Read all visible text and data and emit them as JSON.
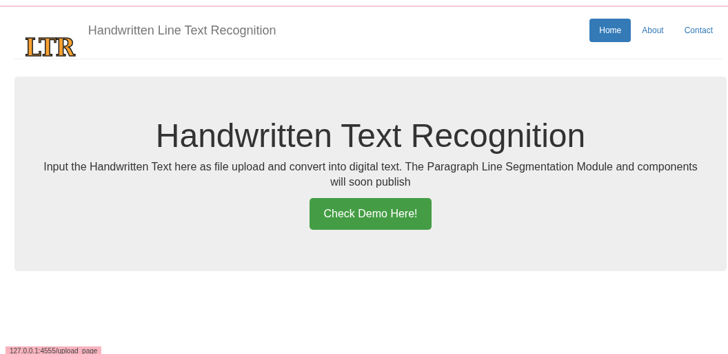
{
  "navbar": {
    "logo": "LTR",
    "title": "Handwritten Line Text Recognition",
    "links": [
      {
        "label": "Home",
        "selected": true
      },
      {
        "label": "About",
        "selected": false
      },
      {
        "label": "Contact",
        "selected": false
      }
    ]
  },
  "hero": {
    "heading": "Handwritten Text Recognition",
    "text": "Input the Handwritten Text here as file upload and convert into digital text. The Paragraph Line Segmentation Module and components will soon publish",
    "button": "Check Demo Here!"
  },
  "status_bar": "127.0.0.1:4555/upload_page"
}
